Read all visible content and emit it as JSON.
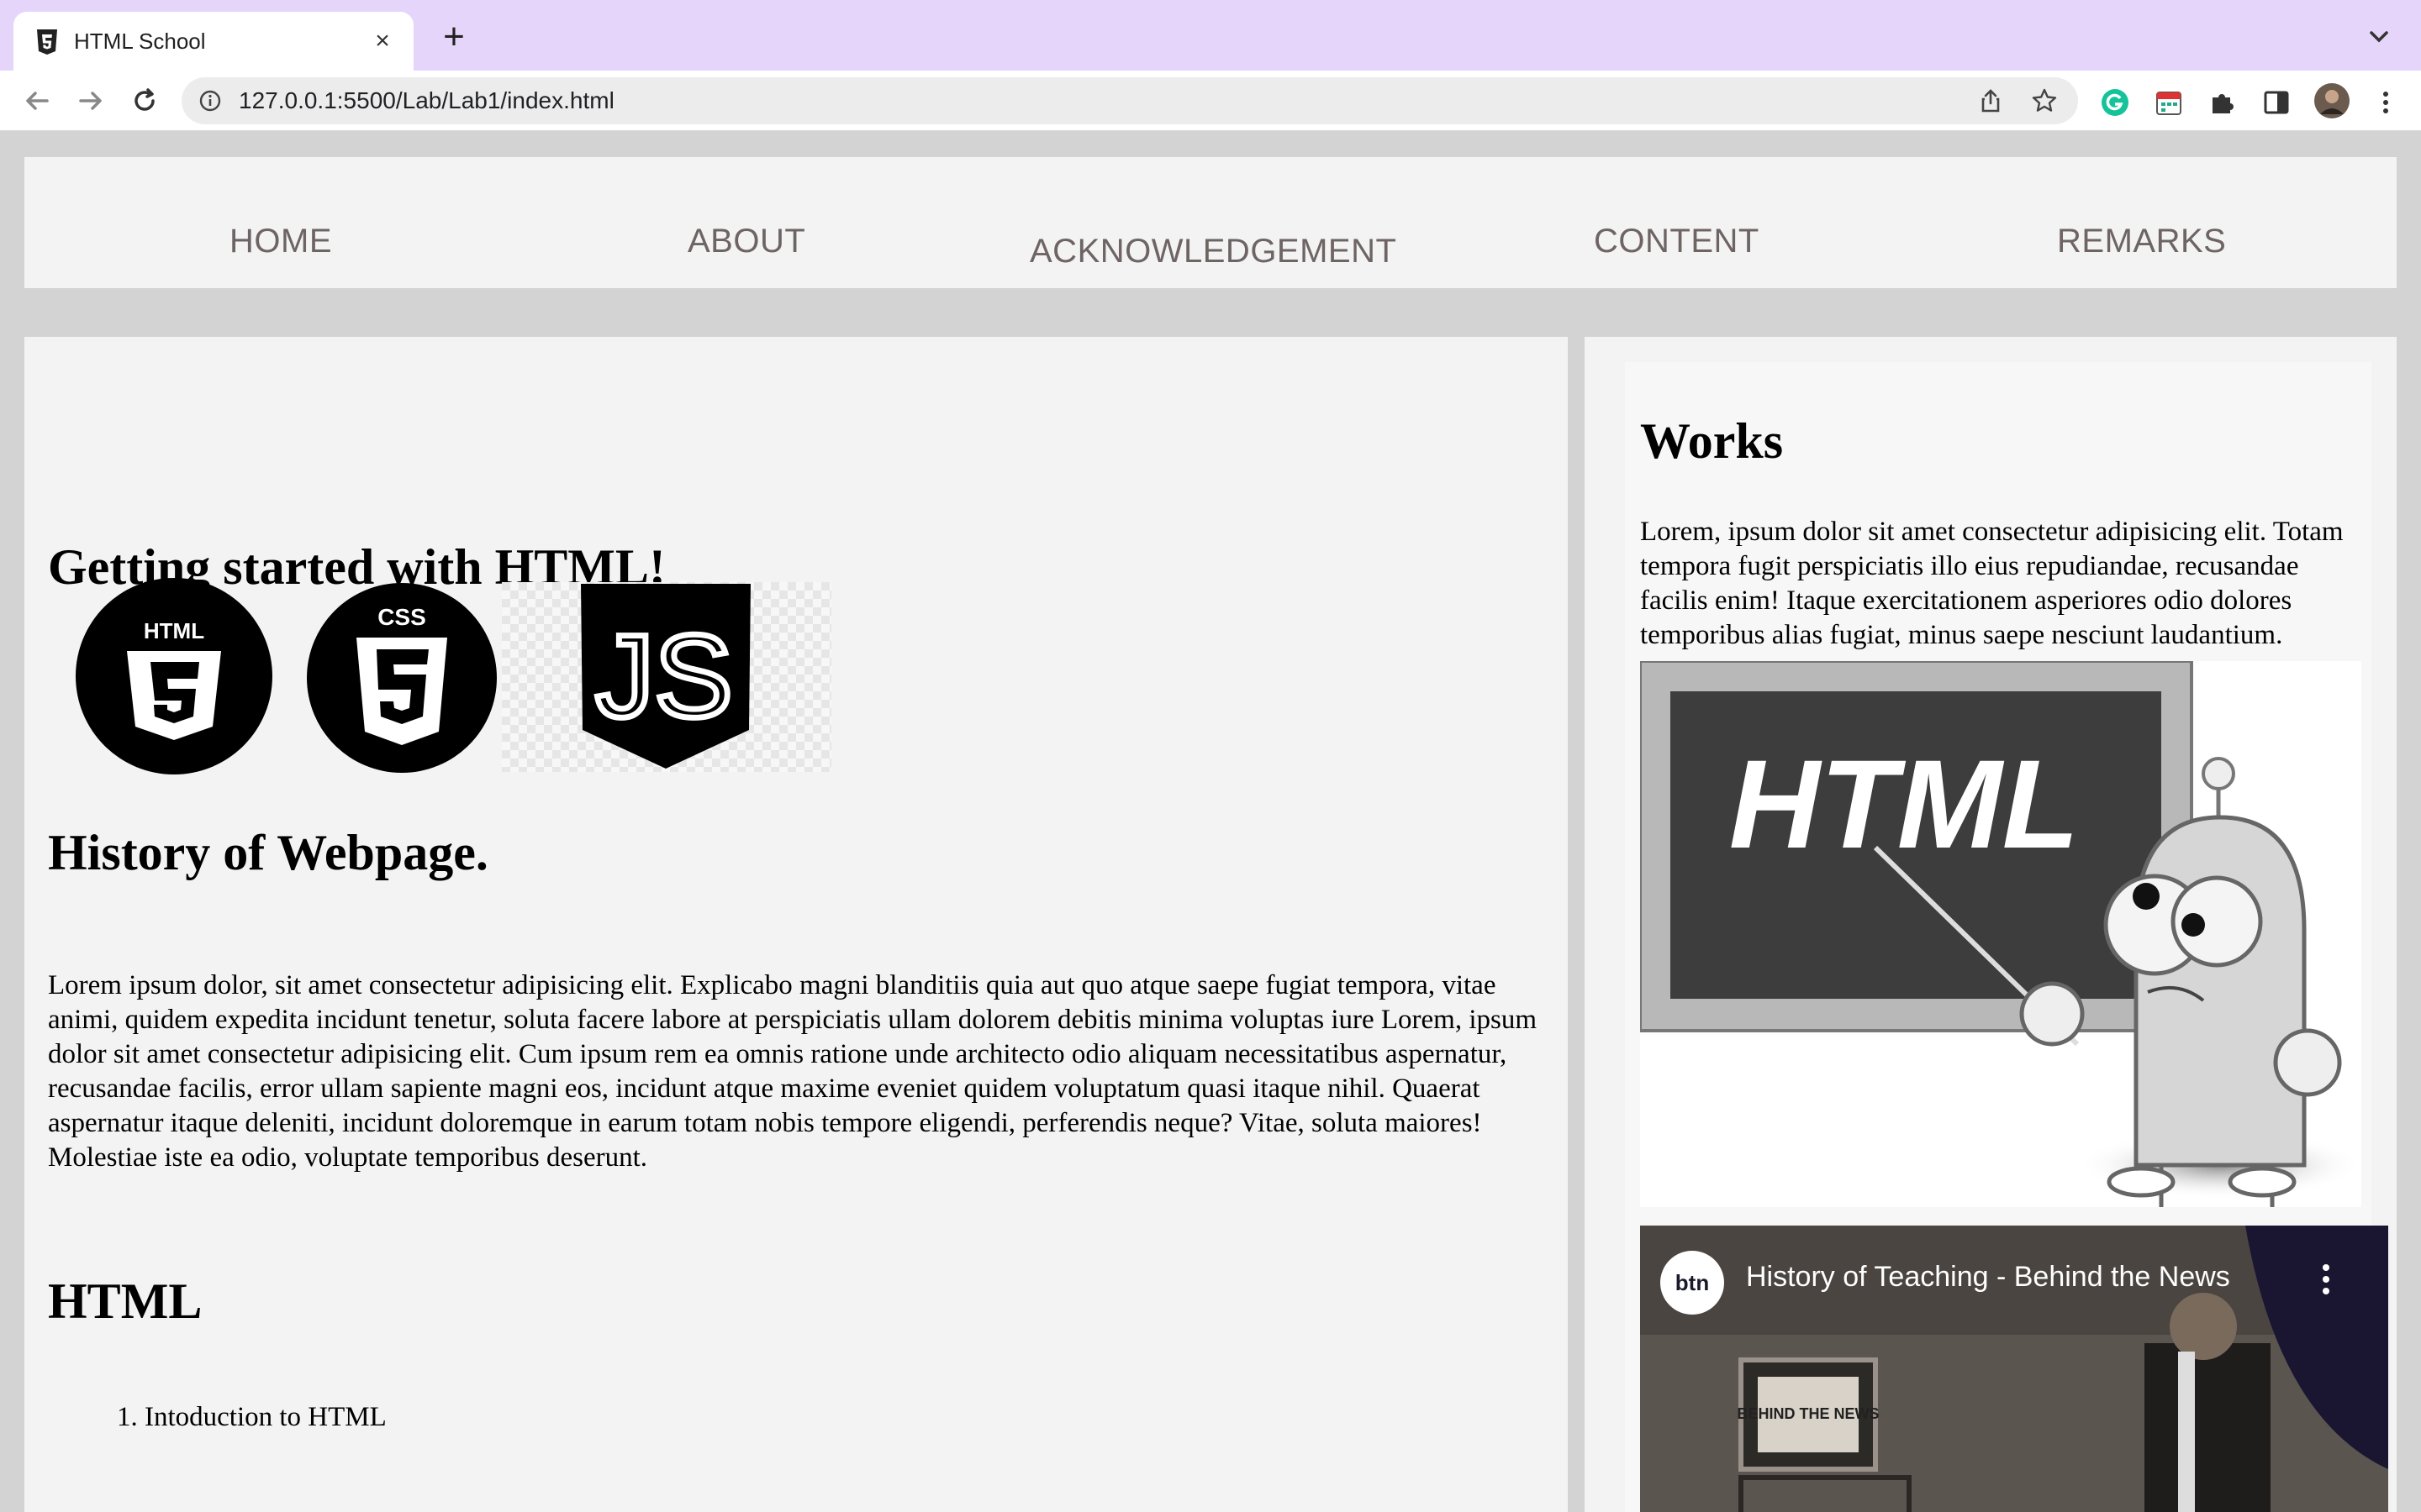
{
  "browser": {
    "tab_title": "HTML School",
    "url": "127.0.0.1:5500/Lab/Lab1/index.html",
    "accent": "#e6d5fa"
  },
  "nav": {
    "items": [
      {
        "label": "HOME"
      },
      {
        "label": "ABOUT"
      },
      {
        "label": "ACKNOWLEDGEMENT"
      },
      {
        "label": "CONTENT"
      },
      {
        "label": "REMARKS"
      }
    ]
  },
  "main": {
    "heading": "Getting started with HTML!",
    "logos": [
      {
        "icon": "html5-logo",
        "text": "HTML"
      },
      {
        "icon": "css3-logo",
        "text": "CSS"
      },
      {
        "icon": "javascript-logo",
        "text": "JS"
      }
    ],
    "history_heading": "History of Webpage.",
    "history_paragraph": "Lorem ipsum dolor, sit amet consectetur adipisicing elit. Explicabo magni blanditiis quia aut quo atque saepe fugiat tempora, vitae animi, quidem expedita incidunt tenetur, soluta facere labore at perspiciatis ullam dolorem debitis minima voluptas iure Lorem, ipsum dolor sit amet consectetur adipisicing elit. Cum ipsum rem ea omnis ratione unde architecto odio aliquam necessitatibus aspernatur, recusandae facilis, error ullam sapiente magni eos, incidunt atque maxime eveniet quidem voluptatum quasi itaque nihil. Quaerat aspernatur itaque deleniti, incidunt doloremque in earum totam nobis tempore eligendi, perferendis neque? Vitae, soluta maiores! Molestiae iste ea odio, voluptate temporibus deserunt.",
    "html_heading": "HTML",
    "list": [
      {
        "number": "1.",
        "text": "Intoduction to HTML"
      }
    ]
  },
  "aside": {
    "heading": "Works",
    "paragraph": "Lorem, ipsum dolor sit amet consectetur adipisicing elit. Totam tempora fugit perspiciatis illo eius repudiandae, recusandae facilis enim! Itaque exercitationem asperiores odio dolores temporibus alias fugiat, minus saepe nesciunt laudantium.",
    "illustration_text": "HTML",
    "video": {
      "channel": "btn",
      "title": "History of Teaching - Behind the News",
      "sign_text": "BEHIND THE NEWS"
    }
  }
}
